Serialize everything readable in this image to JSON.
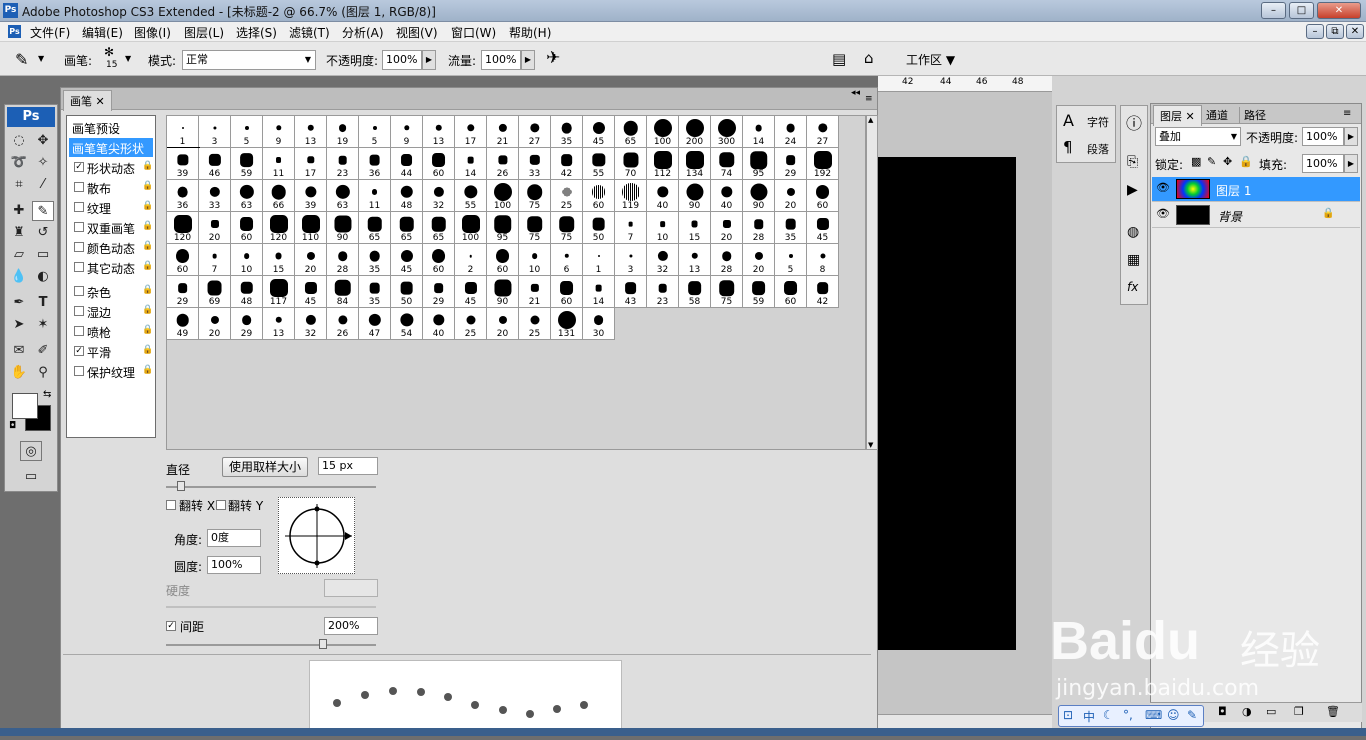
{
  "window": {
    "app_badge": "Ps",
    "title": "Adobe Photoshop CS3 Extended - [未标题-2 @ 66.7% (图层 1, RGB/8)]"
  },
  "menubar": {
    "items": [
      "文件(F)",
      "编辑(E)",
      "图像(I)",
      "图层(L)",
      "选择(S)",
      "滤镜(T)",
      "分析(A)",
      "视图(V)",
      "窗口(W)",
      "帮助(H)"
    ]
  },
  "options": {
    "brush_label": "画笔:",
    "brush_size": "15",
    "mode_label": "模式:",
    "mode_value": "正常",
    "opacity_label": "不透明度:",
    "opacity_value": "100%",
    "flow_label": "流量:",
    "flow_value": "100%",
    "workspace_label": "工作区"
  },
  "toolbox": {
    "badge": "Ps"
  },
  "brush_panel": {
    "tab_label": "画笔",
    "list_header": "画笔预设",
    "list_items": [
      {
        "label": "画笔笔尖形状",
        "checked": null,
        "selected": true
      },
      {
        "label": "形状动态",
        "checked": true
      },
      {
        "label": "散布",
        "checked": false
      },
      {
        "label": "纹理",
        "checked": false
      },
      {
        "label": "双重画笔",
        "checked": false
      },
      {
        "label": "颜色动态",
        "checked": false
      },
      {
        "label": "其它动态",
        "checked": false
      },
      {
        "label": "杂色",
        "checked": false
      },
      {
        "label": "湿边",
        "checked": false
      },
      {
        "label": "喷枪",
        "checked": false
      },
      {
        "label": "平滑",
        "checked": true
      },
      {
        "label": "保护纹理",
        "checked": false
      }
    ],
    "preset_sizes": [
      [
        "1",
        "3",
        "5",
        "9",
        "13",
        "19",
        "5",
        "9",
        "13",
        "17",
        "21",
        "27",
        "35",
        "45",
        "65",
        "100",
        "200",
        "300",
        "14",
        "24",
        "27"
      ],
      [
        "39",
        "46",
        "59",
        "11",
        "17",
        "23",
        "36",
        "44",
        "60",
        "14",
        "26",
        "33",
        "42",
        "55",
        "70",
        "112",
        "134",
        "74",
        "95",
        "29",
        "192"
      ],
      [
        "36",
        "33",
        "63",
        "66",
        "39",
        "63",
        "11",
        "48",
        "32",
        "55",
        "100",
        "75",
        "25",
        "60",
        "119",
        "40",
        "90",
        "40",
        "90",
        "20",
        "60"
      ],
      [
        "120",
        "20",
        "60",
        "120",
        "110",
        "90",
        "65",
        "65",
        "65",
        "100",
        "95",
        "75",
        "75",
        "50",
        "7",
        "10",
        "15",
        "20",
        "28",
        "35",
        "45"
      ],
      [
        "60",
        "7",
        "10",
        "15",
        "20",
        "28",
        "35",
        "45",
        "60",
        "2",
        "60",
        "10",
        "6",
        "1",
        "3",
        "32",
        "13",
        "28",
        "20",
        "5",
        "8"
      ],
      [
        "29",
        "69",
        "48",
        "117",
        "45",
        "84",
        "35",
        "50",
        "29",
        "45",
        "90",
        "21",
        "60",
        "14",
        "43",
        "23",
        "58",
        "75",
        "59",
        "60",
        "42"
      ],
      [
        "49",
        "20",
        "29",
        "13",
        "32",
        "26",
        "47",
        "54",
        "40",
        "25",
        "20",
        "25",
        "131",
        "30"
      ]
    ],
    "diameter_label": "直径",
    "use_sample_size_button": "使用取样大小",
    "diameter_value": "15 px",
    "flip_x_label": "翻转 X",
    "flip_y_label": "翻转 Y",
    "angle_label": "角度:",
    "angle_value": "0度",
    "roundness_label": "圆度:",
    "roundness_value": "100%",
    "hardness_label": "硬度",
    "spacing_label": "间距",
    "spacing_checked": true,
    "spacing_value": "200%"
  },
  "ruler": {
    "labels": [
      "42",
      "44",
      "46",
      "48"
    ]
  },
  "char_panel": {
    "char_tab": "字符",
    "para_tab": "段落"
  },
  "layers_panel": {
    "tabs": [
      "图层",
      "通道",
      "路径"
    ],
    "blend_mode": "叠加",
    "opacity_label": "不透明度:",
    "opacity_value": "100%",
    "lock_label": "锁定:",
    "fill_label": "填充:",
    "fill_value": "100%",
    "layers": [
      {
        "name": "图层 1",
        "selected": true
      },
      {
        "name": "背景",
        "selected": false
      }
    ]
  },
  "ime_bar": {
    "label": "中"
  },
  "watermark": {
    "brand": "Baidu",
    "subtitle": "经验",
    "url": "jingyan.baidu.com"
  },
  "colors": {
    "selection_blue": "#3399ff",
    "title_gradient": "#b9c9dd",
    "panel_bg": "#dedede",
    "document": "#000000"
  }
}
